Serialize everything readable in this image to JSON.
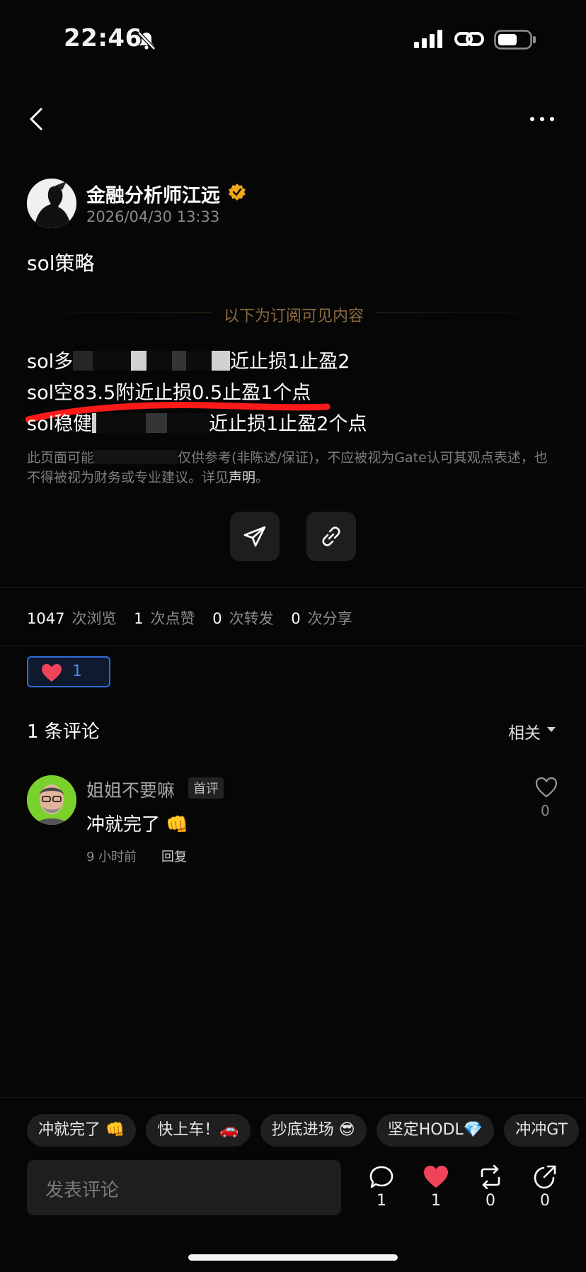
{
  "status_bar": {
    "time": "22:46"
  },
  "author": {
    "name": "金融分析师江远",
    "time": "2026/04/30 13:33"
  },
  "post": {
    "title": "sol策略",
    "subscriber_divider": "以下为订阅可见内容",
    "line1_prefix": "sol多",
    "line1_suffix": "近止损1止盈2",
    "line2": "sol空83.5附近止损0.5止盈1个点",
    "line3_prefix": "sol稳健",
    "line3_suffix": "近止损1止盈2个点",
    "disclaimer_a": "此页面可能",
    "disclaimer_b": "仅供参考(非陈述/保证)，不应被视为Gate认可其观点表述，也不得被视为财务或专业建议。详见",
    "disclaimer_link": "声明",
    "disclaimer_end": "。"
  },
  "stats": {
    "views": "1047",
    "views_label": "次浏览",
    "likes": "1",
    "likes_label": "次点赞",
    "reposts": "0",
    "reposts_label": "次转发",
    "shares": "0",
    "shares_label": "次分享"
  },
  "reaction": {
    "count": "1"
  },
  "comments": {
    "header": "1 条评论",
    "sort": "相关",
    "items": [
      {
        "name": "姐姐不要嘛",
        "badge": "首评",
        "text": "冲就完了 👊",
        "time": "9 小时前",
        "reply": "回复",
        "likes": "0"
      }
    ]
  },
  "quick_replies": [
    "冲就完了 👊",
    "快上车！🚗",
    "抄底进场 😎",
    "坚定HODL💎",
    "冲冲GT"
  ],
  "composer": {
    "placeholder": "发表评论"
  },
  "actions": {
    "comments": "1",
    "likes": "1",
    "reposts": "0",
    "shares": "0"
  },
  "colors": {
    "background": "#060606",
    "accent_blue": "#2f6bd6",
    "like_red": "#f0435a",
    "verified_gold": "#f0a81b",
    "subscribe_gold": "#8a6a3e"
  }
}
